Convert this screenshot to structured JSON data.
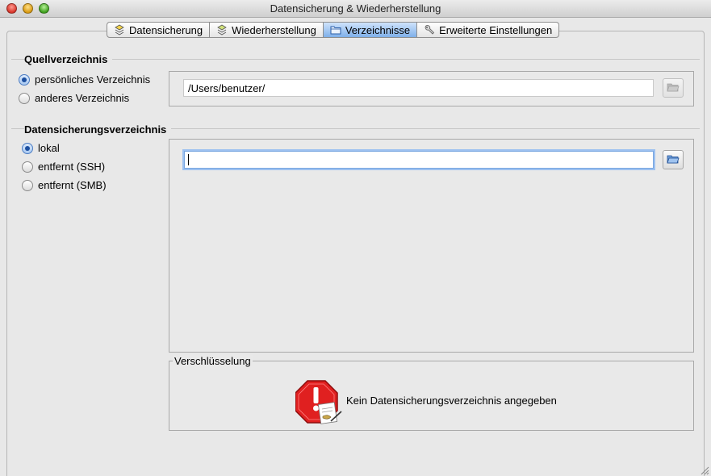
{
  "window": {
    "title": "Datensicherung & Wiederherstellung"
  },
  "tabs": [
    {
      "label": "Datensicherung",
      "icon": "backup-icon"
    },
    {
      "label": "Wiederherstellung",
      "icon": "restore-icon"
    },
    {
      "label": "Verzeichnisse",
      "icon": "folder-icon",
      "active": true
    },
    {
      "label": "Erweiterte Einstellungen",
      "icon": "wrench-icon"
    }
  ],
  "source": {
    "heading": "Quellverzeichnis",
    "options": [
      "persönliches Verzeichnis",
      "anderes Verzeichnis"
    ],
    "selected": "persönliches Verzeichnis",
    "path": "/Users/benutzer/"
  },
  "destination": {
    "heading": "Datensicherungsverzeichnis",
    "options": [
      "lokal",
      "entfernt (SSH)",
      "entfernt (SMB)"
    ],
    "selected": "lokal",
    "path": ""
  },
  "encryption": {
    "title": "Verschlüsselung",
    "message": "Kein Datensicherungsverzeichnis angegeben"
  },
  "colors": {
    "accent": "#4b7cc2",
    "warning": "#e02020"
  }
}
